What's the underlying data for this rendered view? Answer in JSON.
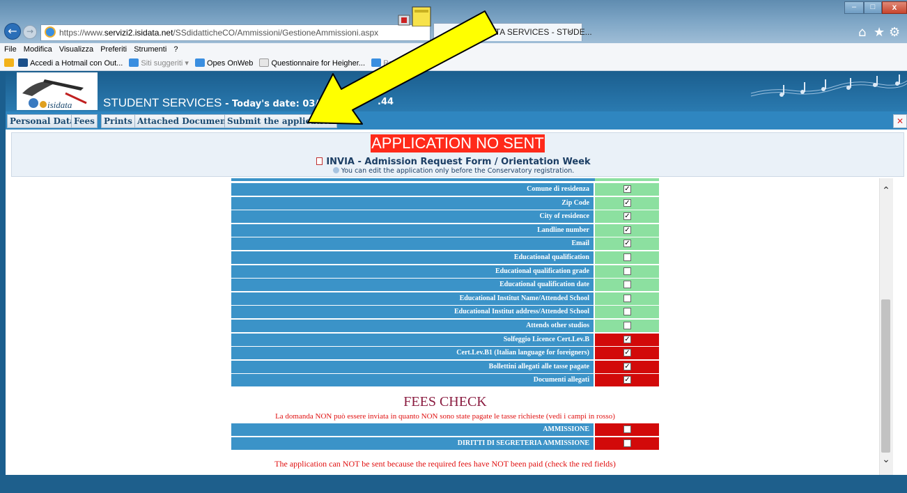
{
  "browser": {
    "url_prefix": "https://www.",
    "url_host": "servizi2.isidata.net",
    "url_path": "/SSdidatticheCO/Ammissioni/GestioneAmmissioni.aspx",
    "tab_title": "DATA SERVICES - STUDE...",
    "tab_close": "×",
    "menu": [
      "File",
      "Modifica",
      "Visualizza",
      "Preferiti",
      "Strumenti",
      "?"
    ],
    "favorites": [
      {
        "label": "Accedi a Hotmail con Out...",
        "icon": "msn-icon",
        "color": "#1a4f8a"
      },
      {
        "label": "Siti suggeriti ▾",
        "icon": "ie-icon",
        "color": "#3a8ee0",
        "dim": true
      },
      {
        "label": "Opes OnWeb",
        "icon": "ie-icon",
        "color": "#3a8ee0"
      },
      {
        "label": "Questionnaire for Heigher...",
        "icon": "page-icon",
        "color": "#cccccc"
      },
      {
        "label": "Ra",
        "icon": "ie-icon",
        "color": "#3a8ee0",
        "dim": true
      }
    ]
  },
  "header": {
    "logo_text": "isidata",
    "title": "STUDENT SERVICES",
    "date_text": "- Today's date: 03/04/",
    "date_tail": ".44"
  },
  "tabs": [
    "Personal Data",
    "Fees",
    "Prints",
    "Attached Documents",
    "Submit the application"
  ],
  "status": {
    "banner": "APPLICATION NO SENT",
    "form_title": "INVIA - Admission Request Form / Orientation Week",
    "info": "You can edit the application only before the Conservatory registration."
  },
  "fields": [
    {
      "label": "Comune di residenza",
      "checked": true,
      "status": "ok"
    },
    {
      "label": "Zip Code",
      "checked": true,
      "status": "ok"
    },
    {
      "label": "City of residence",
      "checked": true,
      "status": "ok"
    },
    {
      "label": "Landline number",
      "checked": true,
      "status": "ok"
    },
    {
      "label": "Email",
      "checked": true,
      "status": "ok"
    },
    {
      "label": "Educational qualification",
      "checked": false,
      "status": "ok"
    },
    {
      "label": "Educational qualification grade",
      "checked": false,
      "status": "ok"
    },
    {
      "label": "Educational qualification date",
      "checked": false,
      "status": "ok"
    },
    {
      "label": "Educational Institut Name/Attended School",
      "checked": false,
      "status": "ok"
    },
    {
      "label": "Educational Institut address/Attended School",
      "checked": false,
      "status": "ok"
    },
    {
      "label": "Attends other studios",
      "checked": false,
      "status": "ok"
    },
    {
      "label": "Solfeggio Licence Cert.Lev.B",
      "checked": true,
      "status": "missing"
    },
    {
      "label": "Cert.Lev.B1 (Italian language for foreigners)",
      "checked": true,
      "status": "missing"
    },
    {
      "label": "Bollettini allegati alle tasse pagate",
      "checked": true,
      "status": "missing"
    },
    {
      "label": "Documenti allegati",
      "checked": true,
      "status": "missing"
    }
  ],
  "fees": {
    "title": "FEES CHECK",
    "note": "La domanda NON può essere inviata in quanto NON sono state pagate le tasse richieste (vedi i campi in rosso)",
    "rows": [
      {
        "label": "AMMISSIONE",
        "checked": false,
        "status": "missing"
      },
      {
        "label": "DIRITTI DI SEGRETERIA AMMISSIONE",
        "checked": false,
        "status": "missing"
      }
    ],
    "bottom_note": "The application can NOT be sent because the required fees have NOT been paid (check the red fields)"
  },
  "colors": {
    "ok_cell": "#8ce0a0",
    "missing_cell": "#d20a0a",
    "label_cell": "#3b93c8",
    "banner": "#ff2a1a",
    "arrow": "#ffff00"
  }
}
